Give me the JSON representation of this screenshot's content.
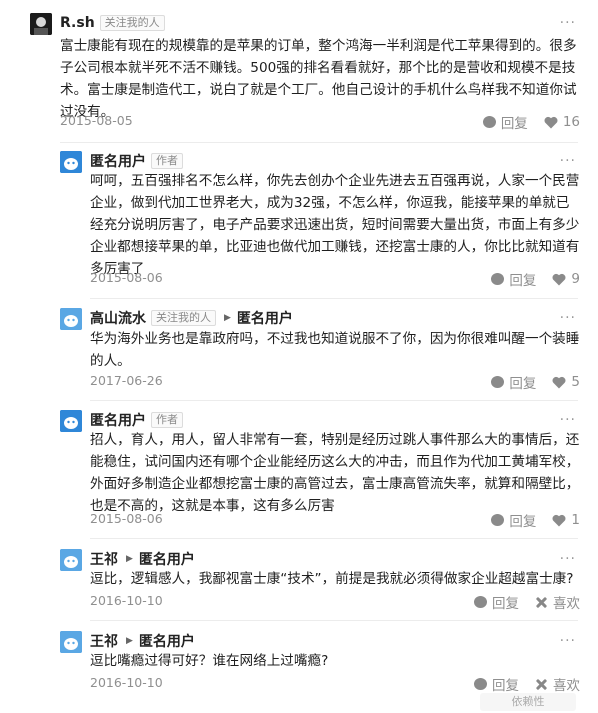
{
  "comments": [
    {
      "user": "R.sh",
      "tag": "关注我的人",
      "text": "富士康能有现在的规模靠的是苹果的订单，整个鸿海一半利润是代工苹果得到的。很多子公司根本就半死不活不赚钱。500强的排名看看就好，那个比的是营收和规模不是技术。富士康是制造代工，说白了就是个工厂。他自己设计的手机什么鸟样我不知道你试过没有。",
      "date": "2015-08-05",
      "reply_label": "回复",
      "likes": "16",
      "more": "···"
    },
    {
      "user": "匿名用户",
      "tag": "作者",
      "text": "呵呵，五百强排名不怎么样，你先去创办个企业先进去五百强再说，人家一个民营企业，做到代加工世界老大，成为32强，不怎么样，你逗我，能接苹果的单就已经充分说明厉害了，电子产品要求迅速出货，短时间需要大量出货，市面上有多少企业都想接苹果的单，比亚迪也做代加工赚钱，还挖富士康的人，你比比就知道有多厉害了",
      "date": "2015-08-06",
      "reply_label": "回复",
      "likes": "9",
      "more": "···"
    },
    {
      "user": "高山流水",
      "tag": "关注我的人",
      "reply_to": "匿名用户",
      "text": "华为海外业务也是靠政府吗，不过我也知道说服不了你，因为你很难叫醒一个装睡的人。",
      "date": "2017-06-26",
      "reply_label": "回复",
      "likes": "5",
      "more": "···"
    },
    {
      "user": "匿名用户",
      "tag": "作者",
      "text": "招人，育人，用人，留人非常有一套，特别是经历过跳人事件那么大的事情后，还能稳住，试问国内还有哪个企业能经历这么大的冲击，而且作为代加工黄埔军校，外面好多制造企业都想挖富士康的高管过去，富士康高管流失率，就算和隔壁比，也是不高的，这就是本事，这有多么厉害",
      "date": "2015-08-06",
      "reply_label": "回复",
      "likes": "1",
      "more": "···"
    },
    {
      "user": "王祁",
      "reply_to": "匿名用户",
      "text": "逗比，逻辑感人，我鄙视富士康“技术”，前提是我就必须得做家企业超越富士康?",
      "date": "2016-10-10",
      "reply_label": "回复",
      "dislike_label": "喜欢",
      "more": "···"
    },
    {
      "user": "王祁",
      "reply_to": "匿名用户",
      "text": "逗比嘴瘾过得可好？谁在网络上过嘴瘾?",
      "date": "2016-10-10",
      "reply_label": "回复",
      "dislike_label": "喜欢",
      "more": "···"
    }
  ],
  "watermark": "依赖性",
  "colors": {
    "text": "#1f1f1f",
    "muted": "#8f8f8f",
    "avatar_blue": "#2f87d8"
  },
  "icons": {
    "reply": "speech-bubble-icon",
    "like": "heart-icon",
    "dislike": "cross-icon",
    "more": "ellipsis-icon",
    "reply_arrow": "triangle-right-icon"
  }
}
